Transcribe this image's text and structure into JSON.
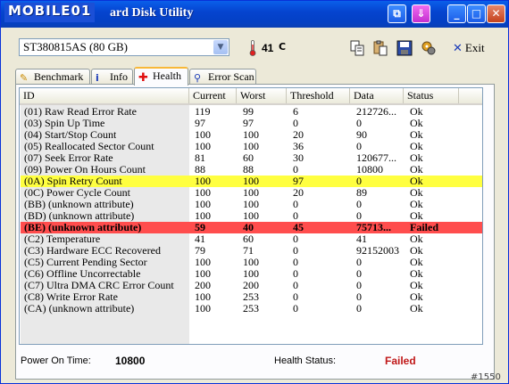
{
  "window": {
    "logo": "MOBILE01",
    "title": "ard Disk Utility",
    "buttons": {
      "minimize": "_",
      "maximize": "□",
      "close": "✕"
    }
  },
  "toolbar": {
    "drive": "ST380815AS (80 GB)",
    "temperature": "41",
    "temperature_unit": "C",
    "exit_label": "Exit"
  },
  "tabs": [
    {
      "label": "Benchmark",
      "icon": "benchmark-icon"
    },
    {
      "label": "Info",
      "icon": "info-icon"
    },
    {
      "label": "Health",
      "icon": "health-icon",
      "active": true
    },
    {
      "label": "Error Scan",
      "icon": "error-scan-icon"
    }
  ],
  "table": {
    "columns": [
      "ID",
      "Current",
      "Worst",
      "Threshold",
      "Data",
      "Status"
    ],
    "rows": [
      {
        "id": "(01) Raw Read Error Rate",
        "current": "119",
        "worst": "99",
        "threshold": "6",
        "data": "212726...",
        "status": "Ok",
        "state": "normal"
      },
      {
        "id": "(03) Spin Up Time",
        "current": "97",
        "worst": "97",
        "threshold": "0",
        "data": "0",
        "status": "Ok",
        "state": "normal"
      },
      {
        "id": "(04) Start/Stop Count",
        "current": "100",
        "worst": "100",
        "threshold": "20",
        "data": "90",
        "status": "Ok",
        "state": "normal"
      },
      {
        "id": "(05) Reallocated Sector Count",
        "current": "100",
        "worst": "100",
        "threshold": "36",
        "data": "0",
        "status": "Ok",
        "state": "normal"
      },
      {
        "id": "(07) Seek Error Rate",
        "current": "81",
        "worst": "60",
        "threshold": "30",
        "data": "120677...",
        "status": "Ok",
        "state": "normal"
      },
      {
        "id": "(09) Power On Hours Count",
        "current": "88",
        "worst": "88",
        "threshold": "0",
        "data": "10800",
        "status": "Ok",
        "state": "normal"
      },
      {
        "id": "(0A) Spin Retry Count",
        "current": "100",
        "worst": "100",
        "threshold": "97",
        "data": "0",
        "status": "Ok",
        "state": "warn"
      },
      {
        "id": "(0C) Power Cycle Count",
        "current": "100",
        "worst": "100",
        "threshold": "20",
        "data": "89",
        "status": "Ok",
        "state": "normal"
      },
      {
        "id": "(BB) (unknown attribute)",
        "current": "100",
        "worst": "100",
        "threshold": "0",
        "data": "0",
        "status": "Ok",
        "state": "normal"
      },
      {
        "id": "(BD) (unknown attribute)",
        "current": "100",
        "worst": "100",
        "threshold": "0",
        "data": "0",
        "status": "Ok",
        "state": "normal"
      },
      {
        "id": "(BE) (unknown attribute)",
        "current": "59",
        "worst": "40",
        "threshold": "45",
        "data": "75713...",
        "status": "Failed",
        "state": "fail"
      },
      {
        "id": "(C2) Temperature",
        "current": "41",
        "worst": "60",
        "threshold": "0",
        "data": "41",
        "status": "Ok",
        "state": "normal"
      },
      {
        "id": "(C3) Hardware ECC Recovered",
        "current": "79",
        "worst": "71",
        "threshold": "0",
        "data": "92152003",
        "status": "Ok",
        "state": "normal"
      },
      {
        "id": "(C5) Current Pending Sector",
        "current": "100",
        "worst": "100",
        "threshold": "0",
        "data": "0",
        "status": "Ok",
        "state": "normal"
      },
      {
        "id": "(C6) Offline Uncorrectable",
        "current": "100",
        "worst": "100",
        "threshold": "0",
        "data": "0",
        "status": "Ok",
        "state": "normal"
      },
      {
        "id": "(C7) Ultra DMA CRC Error Count",
        "current": "200",
        "worst": "200",
        "threshold": "0",
        "data": "0",
        "status": "Ok",
        "state": "normal"
      },
      {
        "id": "(C8) Write Error Rate",
        "current": "100",
        "worst": "253",
        "threshold": "0",
        "data": "0",
        "status": "Ok",
        "state": "normal"
      },
      {
        "id": "(CA) (unknown attribute)",
        "current": "100",
        "worst": "253",
        "threshold": "0",
        "data": "0",
        "status": "Ok",
        "state": "normal"
      }
    ]
  },
  "status_bar": {
    "power_on_label": "Power On Time:",
    "power_on_value": "10800",
    "health_label": "Health Status:",
    "health_value": "Failed",
    "health_color": "#c01818"
  },
  "watermark": "#1550",
  "colors": {
    "warn_row": "#ffff40",
    "fail_row": "#ff4d4d",
    "title_bar": "#0544d0"
  }
}
